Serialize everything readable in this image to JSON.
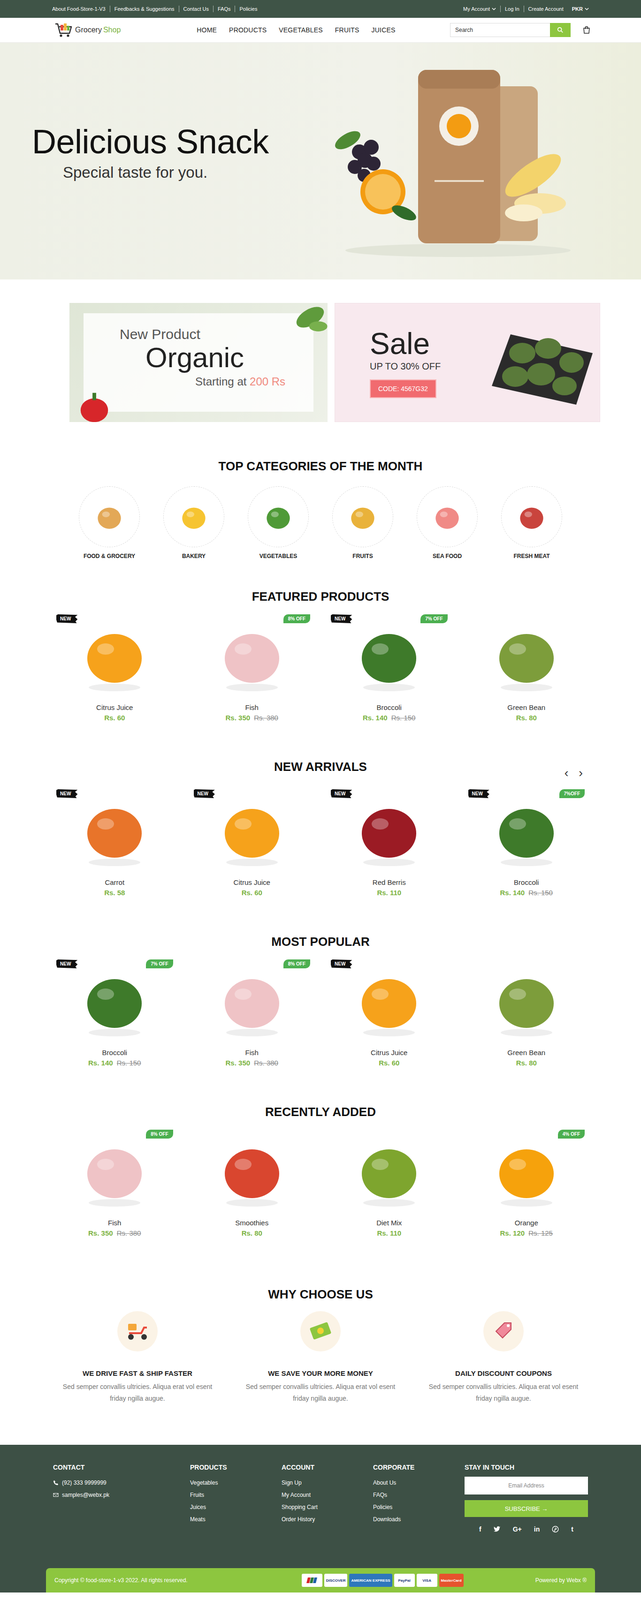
{
  "top_bar": {
    "links": [
      "About Food-Store-1-V3",
      "Feedbacks & Suggestions",
      "Contact Us",
      "FAQs",
      "Policies"
    ],
    "account_links": [
      {
        "label": "My Account",
        "dropdown": true
      },
      {
        "label": "Log In",
        "dropdown": false
      },
      {
        "label": "Create Account",
        "dropdown": false
      },
      {
        "label": "PKR",
        "dropdown": true
      }
    ]
  },
  "header": {
    "logo": {
      "name": "Grocery",
      "accent": "Shop"
    },
    "nav": [
      "HOME",
      "PRODUCTS",
      "VEGETABLES",
      "FRUITS",
      "JUICES"
    ],
    "search": {
      "placeholder": "Search"
    }
  },
  "hero": {
    "title": "Delicious Snack",
    "subtitle": "Special taste for you."
  },
  "promos": {
    "organic": {
      "eyebrow": "New Product",
      "title": "Organic",
      "prefix": "Starting at",
      "price": "200 Rs"
    },
    "sale": {
      "title": "Sale",
      "subtitle": "UP TO 30% OFF",
      "code": "CODE: 4567G32"
    }
  },
  "categories": {
    "title": "TOP CATEGORIES OF THE MONTH",
    "items": [
      {
        "label": "FOOD & GROCERY",
        "color": "#e3a857"
      },
      {
        "label": "BAKERY",
        "color": "#f6c431"
      },
      {
        "label": "VEGETABLES",
        "color": "#4f9a37"
      },
      {
        "label": "FRUITS",
        "color": "#e9b23b"
      },
      {
        "label": "SEA FOOD",
        "color": "#f08a86"
      },
      {
        "label": "FRESH MEAT",
        "color": "#c9443d"
      }
    ]
  },
  "product_sections": [
    {
      "title": "FEATURED PRODUCTS",
      "products": [
        {
          "name": "Citrus Juice",
          "price": "Rs. 60",
          "new_badge": "NEW",
          "color": "#f6a21b"
        },
        {
          "name": "Fish",
          "price": "Rs. 350",
          "old_price": "Rs. 380",
          "discount": "8% OFF",
          "color": "#efc3c6"
        },
        {
          "name": "Broccoli",
          "price": "Rs. 140",
          "old_price": "Rs. 150",
          "new_badge": "NEW",
          "discount": "7% OFF",
          "color": "#3e7a2a"
        },
        {
          "name": "Green Bean",
          "price": "Rs. 80",
          "color": "#7d9d3b"
        }
      ]
    },
    {
      "title": "NEW ARRIVALS",
      "arrows": [
        "‹",
        "›"
      ],
      "products": [
        {
          "name": "Carrot",
          "price": "Rs. 58",
          "new_badge": "NEW",
          "color": "#e8742a"
        },
        {
          "name": "Citrus Juice",
          "price": "Rs. 60",
          "new_badge": "NEW",
          "color": "#f6a21b"
        },
        {
          "name": "Red Berris",
          "price": "Rs. 110",
          "new_badge": "NEW",
          "color": "#9b1b24"
        },
        {
          "name": "Broccoli",
          "price": "Rs. 140",
          "old_price": "Rs. 150",
          "new_badge": "NEW",
          "discount": "7%OFF",
          "color": "#3e7a2a"
        }
      ]
    },
    {
      "title": "MOST POPULAR",
      "products": [
        {
          "name": "Broccoli",
          "price": "Rs. 140",
          "old_price": "Rs. 150",
          "new_badge": "NEW",
          "discount": "7% OFF",
          "color": "#3e7a2a"
        },
        {
          "name": "Fish",
          "price": "Rs. 350",
          "old_price": "Rs. 380",
          "discount": "8% OFF",
          "color": "#efc3c6"
        },
        {
          "name": "Citrus Juice",
          "price": "Rs. 60",
          "new_badge": "NEW",
          "color": "#f6a21b"
        },
        {
          "name": "Green Bean",
          "price": "Rs. 80",
          "color": "#7d9d3b"
        }
      ]
    },
    {
      "title": "RECENTLY ADDED",
      "products": [
        {
          "name": "Fish",
          "price": "Rs. 350",
          "old_price": "Rs. 380",
          "discount": "8% OFF",
          "color": "#efc3c6"
        },
        {
          "name": "Smoothies",
          "price": "Rs. 80",
          "color": "#d9462f"
        },
        {
          "name": "Diet Mix",
          "price": "Rs. 110",
          "color": "#7ea52e"
        },
        {
          "name": "Orange",
          "price": "Rs. 120",
          "old_price": "Rs. 125",
          "discount": "4% OFF",
          "color": "#f6a20c"
        }
      ]
    }
  ],
  "why_choose": {
    "title": "WHY CHOOSE US",
    "items": [
      {
        "title": "WE DRIVE FAST & SHIP FASTER",
        "text": "Sed semper convallis ultricies. Aliqua erat vol esent friday ngilla augue."
      },
      {
        "title": "WE SAVE YOUR MORE MONEY",
        "text": "Sed semper convallis ultricies. Aliqua erat vol esent friday ngilla augue."
      },
      {
        "title": "DAILY DISCOUNT COUPONS",
        "text": "Sed semper convallis ultricies. Aliqua erat vol esent friday ngilla augue."
      }
    ]
  },
  "footer": {
    "contact": {
      "title": "CONTACT",
      "phone": "(92) 333 9999999",
      "email": "samples@webx.pk"
    },
    "columns": [
      {
        "title": "PRODUCTS",
        "links": [
          "Vegetables",
          "Fruits",
          "Juices",
          "Meats"
        ]
      },
      {
        "title": "ACCOUNT",
        "links": [
          "Sign Up",
          "My Account",
          "Shopping Cart",
          "Order History"
        ]
      },
      {
        "title": "CORPORATE",
        "links": [
          "About Us",
          "FAQs",
          "Policies",
          "Downloads"
        ]
      }
    ],
    "newsletter": {
      "title": "STAY IN TOUCH",
      "placeholder": "Email Address",
      "button": "SUBSCRIBE →",
      "social": [
        {
          "kind": "text",
          "glyph": "f"
        },
        {
          "kind": "bird"
        },
        {
          "kind": "text",
          "glyph": "G+"
        },
        {
          "kind": "text",
          "glyph": "in"
        },
        {
          "kind": "pin"
        },
        {
          "kind": "text",
          "glyph": "t"
        }
      ]
    }
  },
  "bottom_bar": {
    "copyright": "Copyright © food-store-1-v3 2022. All rights reserved.",
    "payments": [
      {
        "label": "DISCOVER",
        "color": "#ffffff"
      },
      {
        "label": "AMERICAN EXPRESS",
        "color": "#2e77bc"
      },
      {
        "label": "PayPal",
        "color": "#ffffff"
      },
      {
        "label": "VISA",
        "color": "#ffffff"
      },
      {
        "label": "MasterCard",
        "color": "#e6532d"
      }
    ],
    "powered": "Powered by Webx ®"
  }
}
